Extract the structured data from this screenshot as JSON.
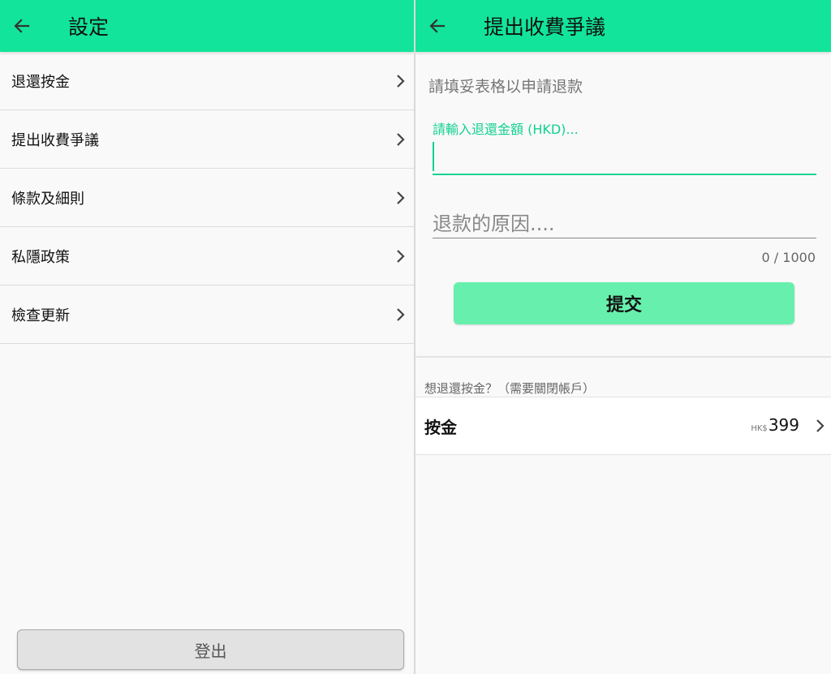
{
  "left_screen": {
    "title": "設定",
    "menu_items": [
      {
        "label": "退還按金"
      },
      {
        "label": "提出收費爭議"
      },
      {
        "label": "條款及細則"
      },
      {
        "label": "私隱政策"
      },
      {
        "label": "檢查更新"
      }
    ],
    "logout_label": "登出"
  },
  "right_screen": {
    "title": "提出收費爭議",
    "intro": "請填妥表格以申請退款",
    "amount_field": {
      "label": "請輸入退還金額 (HKD)...",
      "value": ""
    },
    "reason_field": {
      "placeholder": "退款的原因....",
      "value": ""
    },
    "char_counter": "0 / 1000",
    "submit_label": "提交",
    "deposit_hint": "想退還按金？（需要關閉帳戶）",
    "deposit": {
      "label": "按金",
      "currency": "HK$",
      "amount": "399"
    }
  },
  "colors": {
    "accent": "#12e59b",
    "accent_text": "#12d192",
    "button_fill": "#67f0ad"
  },
  "icons": {
    "back": "arrow-left-icon",
    "chevron": "chevron-right-icon"
  }
}
